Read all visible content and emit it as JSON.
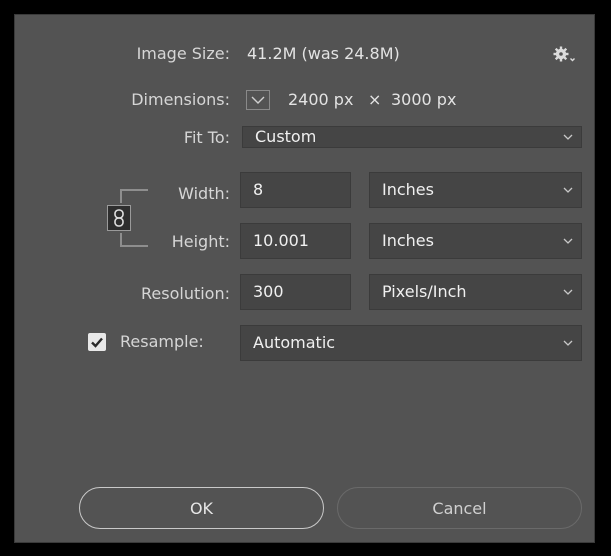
{
  "image_size": {
    "label": "Image Size:",
    "value": "41.2M (was 24.8M)"
  },
  "dimensions": {
    "label": "Dimensions:",
    "width": "2400 px",
    "times": "×",
    "height": "3000 px"
  },
  "fit_to": {
    "label": "Fit To:",
    "value": "Custom"
  },
  "width": {
    "label": "Width:",
    "value": "8",
    "unit": "Inches"
  },
  "height": {
    "label": "Height:",
    "value": "10.001",
    "unit": "Inches"
  },
  "resolution": {
    "label": "Resolution:",
    "value": "300",
    "unit": "Pixels/Inch"
  },
  "resample": {
    "label": "Resample:",
    "value": "Automatic",
    "checked": true
  },
  "buttons": {
    "ok": "OK",
    "cancel": "Cancel"
  },
  "icons": [
    "gear-icon",
    "chevron-down-icon",
    "link-icon",
    "checkbox-checked-icon"
  ]
}
